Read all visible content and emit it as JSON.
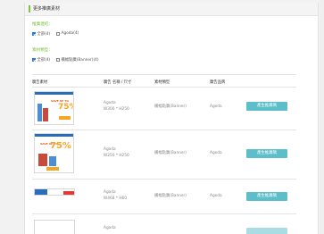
{
  "header": {
    "title": "更多推廣素材"
  },
  "filters": {
    "platform": {
      "label": "推廣連結：",
      "options": [
        {
          "label": "全部(4)",
          "checked": true
        },
        {
          "label": "Agoda(4)",
          "checked": false
        }
      ]
    },
    "material_type": {
      "label": "素材類型：",
      "options": [
        {
          "label": "全部(4)",
          "checked": true
        },
        {
          "label": "橫幅點廣(Banner)(4)",
          "checked": false
        }
      ]
    }
  },
  "table": {
    "headers": [
      "廣告素材",
      "廣告 名稱 / 尺寸",
      "素材類型",
      "廣告品牌"
    ],
    "rows": [
      {
        "name": "Agoda",
        "size": "W300 * H250",
        "type": "橫幅點廣(Banner)",
        "brand": "Agoda",
        "button": "產生推廣碼",
        "thumb_text": "SAVE UP TO",
        "thumb_percent": "75%"
      },
      {
        "name": "Agoda",
        "size": "W250 * H250",
        "type": "橫幅點廣(Banner)",
        "brand": "Agoda",
        "button": "產生推廣碼",
        "thumb_text": "SAVE UP TO",
        "thumb_percent": "75%"
      },
      {
        "name": "Agoda",
        "size": "W468 * H60",
        "type": "橫幅點廣(Banner)",
        "brand": "Agoda",
        "button": "產生推廣碼"
      },
      {
        "name": "Agoda",
        "button": ""
      }
    ]
  },
  "colors": {
    "accent": "#7fc241",
    "button": "#5bbec9",
    "checkbox": "#2f73d6"
  }
}
